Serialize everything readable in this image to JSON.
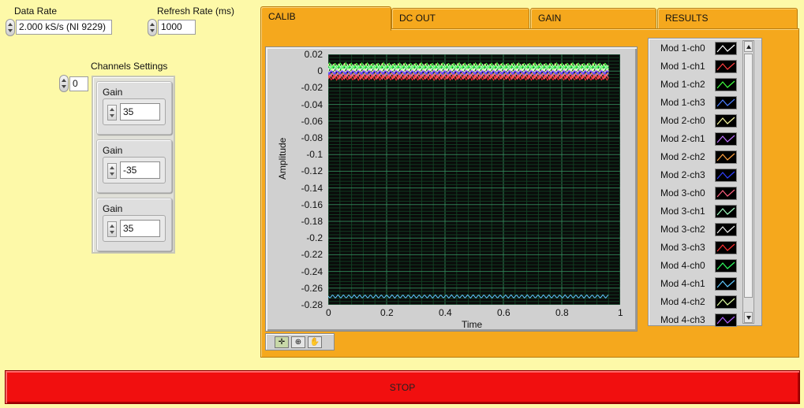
{
  "controls": {
    "data_rate_label": "Data Rate",
    "data_rate_value": "2.000 kS/s (NI 9229)",
    "refresh_rate_label": "Refresh Rate (ms)",
    "refresh_rate_value": "1000",
    "channels_settings_label": "Channels Settings",
    "channel_index_value": "0",
    "gain_label": "Gain",
    "gains": [
      "35",
      "-35",
      "35"
    ]
  },
  "tabs": [
    {
      "label": "CALIB",
      "active": true
    },
    {
      "label": "DC OUT",
      "active": false
    },
    {
      "label": "GAIN",
      "active": false
    },
    {
      "label": "RESULTS",
      "active": false
    }
  ],
  "chart_data": {
    "type": "line",
    "xlabel": "Time",
    "ylabel": "Amplitude",
    "xlim": [
      0,
      1
    ],
    "ylim": [
      -0.28,
      0.02
    ],
    "x_ticks": [
      "0",
      "0.2",
      "0.4",
      "0.6",
      "0.8",
      "1"
    ],
    "y_ticks": [
      "0.02",
      "0",
      "-0.02",
      "-0.04",
      "-0.06",
      "-0.08",
      "-0.1",
      "-0.12",
      "-0.14",
      "-0.16",
      "-0.18",
      "-0.2",
      "-0.22",
      "-0.24",
      "-0.26",
      "-0.28"
    ],
    "grid": true,
    "legend_placement": "right",
    "series": [
      {
        "name": "Mod 1-ch0",
        "color": "#ffffff",
        "center": 0.004,
        "amplitude": 0.004
      },
      {
        "name": "Mod 1-ch1",
        "color": "#ff4040",
        "center": -0.006,
        "amplitude": 0.003
      },
      {
        "name": "Mod 1-ch2",
        "color": "#40ff40",
        "center": 0.006,
        "amplitude": 0.004
      },
      {
        "name": "Mod 1-ch3",
        "color": "#4a7dff",
        "center": -0.003,
        "amplitude": 0.002
      },
      {
        "name": "Mod 2-ch0",
        "color": "#ffffa0",
        "center": 0.005,
        "amplitude": 0.004
      },
      {
        "name": "Mod 2-ch1",
        "color": "#c070ff",
        "center": -0.004,
        "amplitude": 0.003
      },
      {
        "name": "Mod 2-ch2",
        "color": "#ffa040",
        "center": -0.005,
        "amplitude": 0.003
      },
      {
        "name": "Mod 2-ch3",
        "color": "#3040ff",
        "center": -0.002,
        "amplitude": 0.002
      },
      {
        "name": "Mod 3-ch0",
        "color": "#ff6080",
        "center": -0.007,
        "amplitude": 0.003
      },
      {
        "name": "Mod 3-ch1",
        "color": "#a0ffc0",
        "center": 0.003,
        "amplitude": 0.003
      },
      {
        "name": "Mod 3-ch2",
        "color": "#f0f0f0",
        "center": 0.002,
        "amplitude": 0.002
      },
      {
        "name": "Mod 3-ch3",
        "color": "#ff3030",
        "center": -0.008,
        "amplitude": 0.003
      },
      {
        "name": "Mod 4-ch0",
        "color": "#30ff60",
        "center": 0.004,
        "amplitude": 0.003
      },
      {
        "name": "Mod 4-ch1",
        "color": "#60c8ff",
        "center": -0.27,
        "amplitude": 0.002
      },
      {
        "name": "Mod 4-ch2",
        "color": "#e0ffa0",
        "center": 0.001,
        "amplitude": 0.002
      },
      {
        "name": "Mod 4-ch3",
        "color": "#b060ff",
        "center": -0.001,
        "amplitude": 0.002
      }
    ]
  },
  "stop_label": "STOP"
}
